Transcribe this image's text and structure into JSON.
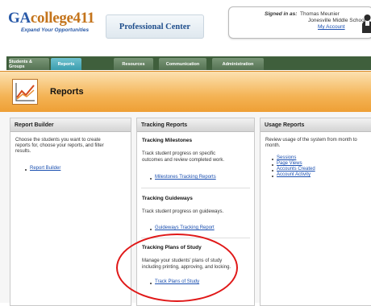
{
  "header": {
    "logo_prefix": "GA",
    "logo_suffix": "college411",
    "tagline": "Expand Your Opportunities",
    "pro_center": "Professional Center",
    "signed_in_label": "Signed in as:",
    "user_name": "Thomas Meunier",
    "school": "Jonesville Middle School",
    "account_link": "My Account"
  },
  "nav": {
    "tabs": [
      "Students & Groups",
      "Reports",
      "Resources",
      "Communication",
      "Administration"
    ],
    "active": "Reports"
  },
  "banner": {
    "title": "Reports",
    "icon": "line-chart-icon"
  },
  "panels": {
    "report_builder": {
      "title": "Report Builder",
      "description_lines": [
        "Choose the students you want to create",
        "reports for, choose your reports, and filter",
        "results."
      ],
      "link": "Report Builder"
    },
    "tracking_reports": {
      "title": "Tracking Reports",
      "milestones": {
        "title": "Tracking Milestones",
        "description_lines": [
          "Track student progress on specific",
          "outcomes and review completed work."
        ],
        "link": "Milestones Tracking Reports"
      },
      "guideways": {
        "title": "Tracking Guideways",
        "description_lines": [
          "Track student progress on guideways."
        ],
        "link": "Guideways Tracking Report"
      },
      "plans": {
        "title": "Tracking Plans of Study",
        "description_lines": [
          "Manage your students' plans of study",
          "including printing, approving, and locking."
        ],
        "link": "Track Plans of Study"
      }
    },
    "usage_reports": {
      "title": "Usage Reports",
      "description_lines": [
        "Review usage of the system from month to",
        "month."
      ],
      "links": [
        "Sessions",
        "Page Views",
        "Accounts Created",
        "Account Activity"
      ]
    }
  },
  "colors": {
    "banner_orange": "#f4b456",
    "nav_green": "#3f5f3c",
    "active_tab": "#3b9dae",
    "link_blue": "#1a4fb0",
    "highlight_circle": "#e01818"
  }
}
